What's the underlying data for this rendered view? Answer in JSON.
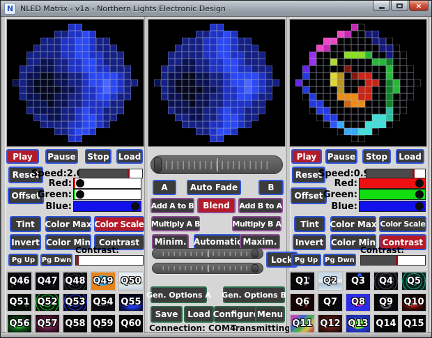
{
  "window": {
    "title": "NLED Matrix - v1a - Northern Lights Electronic Design",
    "icon_letter": "N",
    "close_glyph": "×"
  },
  "status": {
    "connection": "Connection: COM4",
    "transmitting": "Transmitting:",
    "transmit_dot": "●"
  },
  "colors": {
    "accent_red": "#b31b28",
    "border_blue": "#2e54da",
    "border_purple": "#8d4a96",
    "border_green": "#2c6b4c",
    "red_channel": "#ee1111",
    "green_channel": "#11dd11",
    "blue_channel": "#1111ee"
  },
  "left_panel": {
    "play": "Play",
    "pause": "Pause",
    "stop": "Stop",
    "load": "Load",
    "reset": "Reset",
    "offset": "Offset",
    "speed": "Speed:2.0",
    "speed_fill": 0.78,
    "red_label": "Red:",
    "green_label": "Green:",
    "blue_label": "Blue:",
    "red_value": 0.02,
    "green_value": 0.02,
    "blue_value": 1,
    "tint": "Tint",
    "color_max": "Color Max",
    "color_scale": "Color Scale",
    "invert": "Invert",
    "color_min": "Color Min",
    "contrast": "Contrast",
    "pg_up": "Pg Up",
    "pg_dwn": "Pg Dwn",
    "contrast_label": "Contrast:",
    "contrast_fill": 0.02,
    "q_buttons": [
      {
        "label": "Q46",
        "bg": "radial-gradient(circle at 28% 40%,#3c3c46 1.2px,transparent 2.2px),radial-gradient(circle at 68% 66%,#34343e 1.2px,transparent 2.2px),radial-gradient(circle at 52% 22%,#303038 1px,transparent 1.8px),radial-gradient(circle at 18% 78%,#2c2c34 1px,transparent 1.8px),#0a0a0e"
      },
      {
        "label": "Q47",
        "bg": "radial-gradient(circle at 60% 35%,#3a3a44 1.2px,transparent 2.2px),radial-gradient(circle at 30% 68%,#32323c 1.2px,transparent 2.1px),radial-gradient(circle at 75% 75%,#2e2e36 1px,transparent 1.8px),#0a0a0e"
      },
      {
        "label": "Q48",
        "bg": "repeating-radial-gradient(circle at 50% 55%,#30303a 0 1.3px,#08080a 1.3px 5px)"
      },
      {
        "label": "Q49",
        "bg": "radial-gradient(ellipse 60% 55% at 48% 46%,#3aaae6 0 52%,#e6831c 56%)"
      },
      {
        "label": "Q50",
        "bg": "linear-gradient(180deg,#e6edf3 0 52%,#b4c6a6 58%,#dfe7ec 72%,#c4d0d9)"
      },
      {
        "label": "Q51",
        "bg": "radial-gradient(circle at 30% 55%,#1e6424 1.3px,transparent 2.3px),radial-gradient(circle at 62% 28%,#195426 1.2px,transparent 2.1px),radial-gradient(circle at 78% 72%,#1b5a22 1px,transparent 1.9px),#050b05"
      },
      {
        "label": "Q52",
        "bg": "repeating-radial-gradient(circle at 50% 50%,#17a21e 0 1.3px,#021408 1.3px 5.2px)"
      },
      {
        "label": "Q53",
        "bg": "repeating-radial-gradient(circle at 50% 50%,#2233c8 0 1.3px,#020413 1.3px 5.2px)"
      },
      {
        "label": "Q54",
        "bg": "radial-gradient(ellipse 52% 30% at 50% 58%,#33333a 0 40%,#0b0b0d 52%),#09090b"
      },
      {
        "label": "Q55",
        "bg": "radial-gradient(ellipse 75% 55% at 55% 68%,#2038da 0 30%,#0b1452 58%,#050617)"
      },
      {
        "label": "Q56",
        "bg": "radial-gradient(ellipse 72% 58% at 45% 55%,#21b02c 0 28%,#0d4d16 55%,#051108)"
      },
      {
        "label": "Q57",
        "bg": "radial-gradient(ellipse 68% 58% at 50% 50%,#7e2254 0 38%,#44112c 68%,#220916)"
      },
      {
        "label": "Q58",
        "bg": "radial-gradient(circle at 35% 30%,#2e2e36 1.2px,transparent 2.1px),radial-gradient(circle at 70% 62%,#2a2a32 1.1px,transparent 2px),#070709"
      },
      {
        "label": "Q59",
        "bg": "radial-gradient(circle at 45% 70%,#303038 1.2px,transparent 2.1px),radial-gradient(circle at 25% 30%,#2c2c34 1px,transparent 1.9px),#070709"
      },
      {
        "label": "Q60",
        "bg": "#07070a"
      }
    ]
  },
  "middle_panel": {
    "fade_value": 0.02,
    "a": "A",
    "auto_fade": "Auto Fade",
    "b": "B",
    "add_a_to_b": "Add A to B",
    "blend": "Blend",
    "add_b_to_a": "Add B to A",
    "multiply_ab": "Multiply A B",
    "multiply_ba": "Multiply B A",
    "minim": "Minim.",
    "automatic": "Automatic",
    "maxim": "Maxim.",
    "slider1_value": 0.97,
    "slider2_value": 0.97,
    "lock": "Lock",
    "gen_options_a": "Gen. Options A",
    "gen_options_b": "Gen. Options B",
    "save": "Save",
    "load": "Load",
    "configure": "Configure",
    "menu": "Menu"
  },
  "right_panel": {
    "play": "Play",
    "pause": "Pause",
    "stop": "Stop",
    "load": "Load",
    "reset": "Reset",
    "offset": "Offset",
    "speed": "Speed:0.9",
    "speed_fill": 0.8,
    "red_label": "Red:",
    "green_label": "Green:",
    "blue_label": "Blue:",
    "red_value": 1,
    "green_value": 1,
    "blue_value": 1,
    "tint": "Tint",
    "color_max": "Color Max",
    "color_scale": "Color Scale",
    "invert": "Invert",
    "color_min": "Color Min",
    "contrast": "Contrast",
    "pg_up": "Pg Up",
    "pg_dwn": "Pg Dwn",
    "contrast_label": "Contrast:",
    "contrast_fill": 0.55,
    "q_buttons": [
      {
        "label": "Q1",
        "bg": "radial-gradient(circle at 30% 44%,#80808a 1.8px,transparent 2.8px),radial-gradient(circle at 62% 66%,#70707a 1.4px,transparent 2.4px),radial-gradient(circle at 76% 32%,#666670 1.3px,transparent 2.2px),#08080a"
      },
      {
        "label": "Q2",
        "bg": "linear-gradient(180deg,#c6dbeb 0 34%,#edf3f7 48%,#a9c1d5 66%,#d9e5ed)"
      },
      {
        "label": "Q3",
        "bg": "radial-gradient(circle at 56% 16%,#3252f2 2.2px,transparent 3.8px),#040407"
      },
      {
        "label": "Q4",
        "bg": "repeating-radial-gradient(circle at 50% 50%,#3c3c44 0 1.3px,#0a0a0d 1.3px 5.2px)"
      },
      {
        "label": "Q5",
        "bg": "repeating-radial-gradient(circle at 50% 50%,#169078 0 1.3px,#07211c 1.3px 5.2px)"
      },
      {
        "label": "Q6",
        "bg": "radial-gradient(circle at 32% 42%,#c42319 1.6px,transparent 2.6px),radial-gradient(circle at 66% 70%,#941a11 1.3px,transparent 2.3px),radial-gradient(circle at 78% 28%,#a61e14 1.2px,transparent 2.1px),#150505"
      },
      {
        "label": "Q7",
        "bg": "radial-gradient(circle at 40% 55%,#2e2e36 1.2px,transparent 2.1px),radial-gradient(circle at 68% 30%,#2a2a32 1px,transparent 1.9px),#070709"
      },
      {
        "label": "Q8",
        "bg": "radial-gradient(ellipse 56% 50% at 50% 50%,#e219da 0 46%,#2b2bea 51%)"
      },
      {
        "label": "Q9",
        "bg": "radial-gradient(circle at 50% 52%,#0d0d10 0 28%,#8d8d95 34%,#111115 42%,#070709 58%)"
      },
      {
        "label": "Q10",
        "bg": "radial-gradient(ellipse 62% 46% at 44% 60%,#c42218 0 26%,#420b08 58%,#110404)"
      },
      {
        "label": "Q11",
        "bg": "linear-gradient(135deg,#bb4abb 0 18%,#4a68ca 28% 38%,#49aa59 48% 58%,#c9ba49 68% 78%,#c95949 88%)"
      },
      {
        "label": "Q12",
        "bg": "radial-gradient(ellipse 72% 62% at 50% 50%,#5c1a13 0 48%,#33110d 72%,#1a0907)"
      },
      {
        "label": "Q13",
        "bg": "radial-gradient(ellipse 60% 56% at 50% 50%,#5ae229 0 50%,#2b3bca 56%,#1a2aa4)"
      },
      {
        "label": "Q14",
        "bg": "radial-gradient(circle at 55% 40%,#22222a 1.2px,transparent 2px),#060609"
      },
      {
        "label": "Q15",
        "bg": "radial-gradient(circle at 38% 62%,#155e2c 1.3px,transparent 2.2px),radial-gradient(circle at 72% 28%,#12532c 1px,transparent 1.9px),#050707"
      }
    ]
  },
  "displays": {
    "palette": {
      "_": "#000000",
      "0": "#05081e",
      "1": "#0a1252",
      "2": "#152085",
      "3": "#1e32c8",
      "4": "#2a48f5",
      "5": "#4a66ff",
      "M": "#c428b4",
      "P": "#f046c8",
      "V": "#9a30ee",
      "U": "#6428e8",
      "B": "#2438e0",
      "E": "#2a58f8",
      "b": "#141878",
      "C": "#38a8f8",
      "c": "#40e0d8",
      "T": "#28bc9c",
      "G": "#28b838",
      "g": "#128026",
      "L": "#8ae020",
      "l": "#b0dc30",
      "Y": "#e0d832",
      "d": "#b89420",
      "O": "#ec8c14",
      "o": "#cc6610",
      "R": "#cc2414",
      "m": "#801810"
    },
    "blue_grid": [
      "........33........",
      "......223343......",
      "....2223344322....",
      "...222233443222...",
      "..22222334433222..",
      "..22112233443222..",
      ".2211122334433222.",
      ".2110011223444432.",
      "121000112234454322",
      ".2100001123345432.",
      ".2110011223344322.",
      "..11101122333322..",
      "..21111223433222..",
      "...221122344322...",
      "....2222334432....",
      "......223443......",
      "........33........"
    ],
    "spiral_grid": [
      "........M_........",
      "......PM__bb......",
      "....PP_____bb_....",
      "...PM_______bb_...",
      "..V____LLLG__b__..",
      "..V__l_____GGg__..",
      ".U_____m_____G___.",
      ".B___Yd_mRR__G___.",
      "U____Yd___RR_gG___",
      ".B____d__RR__gG__.",
      "._B___OOORR__g___.",
      "..BB___oOO___g__..",
      ".._BB________T__..",
      "..._BB_____ccT_...",
      "...._EC___ccc_....",
      "......_CCcc_......",
      "........__........"
    ]
  }
}
